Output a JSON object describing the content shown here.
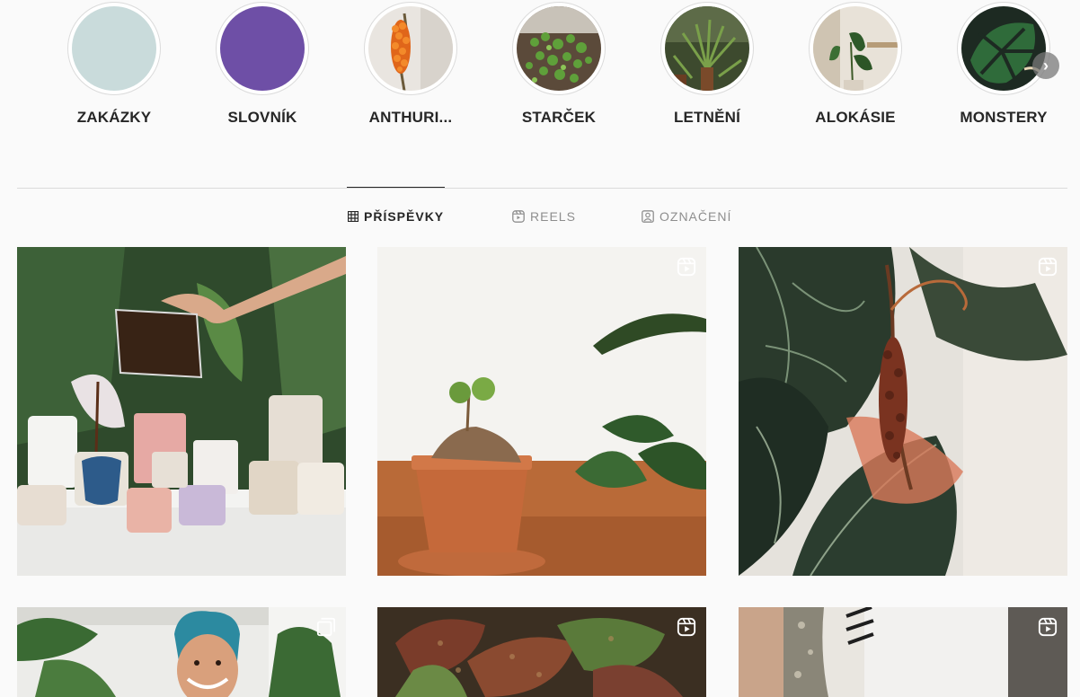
{
  "highlights": [
    {
      "label": "ZAKÁZKY",
      "cover": "light-teal-solid"
    },
    {
      "label": "SLOVNÍK",
      "cover": "purple-solid"
    },
    {
      "label": "ANTHURI...",
      "cover": "anthurium-orange-berries"
    },
    {
      "label": "STARČEK",
      "cover": "string-of-pearls"
    },
    {
      "label": "LETNĚNÍ",
      "cover": "palm-plants"
    },
    {
      "label": "ALOKÁSIE",
      "cover": "alocasia-room"
    },
    {
      "label": "MONSTERY",
      "cover": "monstera-leaf"
    }
  ],
  "highlight_next_icon": "chevron-right-icon",
  "tabs": [
    {
      "label": "PŘÍSPĚVKY",
      "icon": "grid-icon",
      "active": true
    },
    {
      "label": "REELS",
      "icon": "reels-icon",
      "active": false
    },
    {
      "label": "OZNAČENÍ",
      "icon": "tagged-icon",
      "active": false
    }
  ],
  "posts": [
    {
      "subject": "ceramic cups with coffee pour",
      "badge": null
    },
    {
      "subject": "caudex plant in terracotta pot",
      "badge": "reel-icon"
    },
    {
      "subject": "anthurium leaves with dried spadix",
      "badge": "reel-icon"
    },
    {
      "subject": "man with blue hair among plants",
      "badge": "carousel-icon"
    },
    {
      "subject": "textured begonia leaves",
      "badge": "reel-icon"
    },
    {
      "subject": "plant stem against white wall",
      "badge": "reel-icon"
    }
  ],
  "colors": {
    "background": "#fafafa",
    "text": "#262626",
    "muted": "#8e8e8e",
    "divider": "#dbdbdb",
    "slovnik_cover": "#6e4fa6",
    "zakazky_cover": "#c9dbdb"
  }
}
